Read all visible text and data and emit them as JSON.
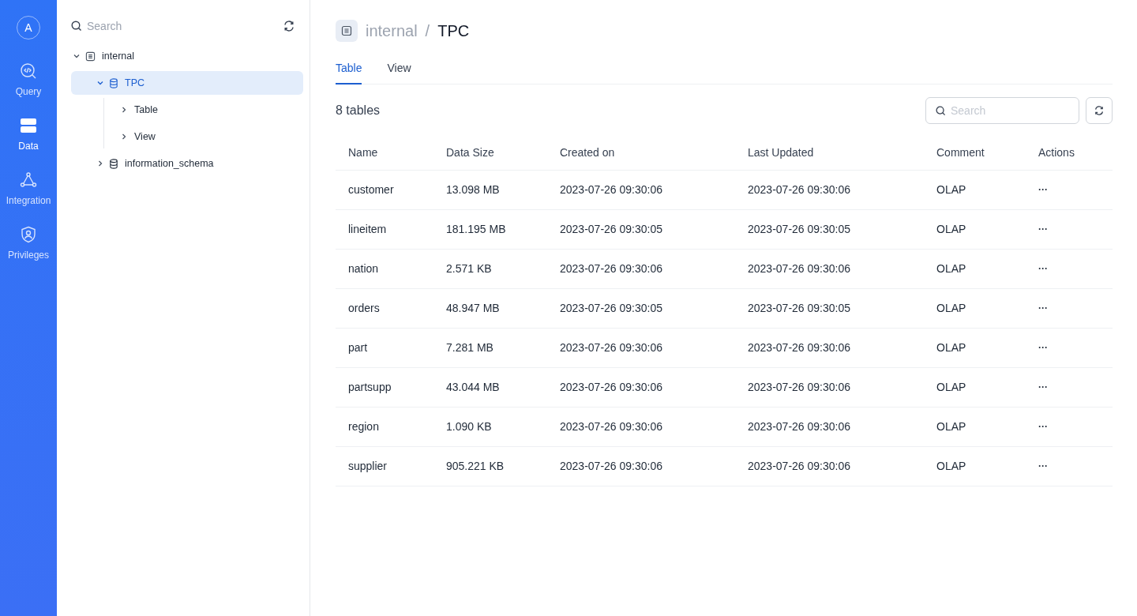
{
  "nav": {
    "avatar": "A",
    "items": [
      {
        "label": "Query",
        "kind": "query",
        "selected": false
      },
      {
        "label": "Data",
        "kind": "data",
        "selected": true
      },
      {
        "label": "Integration",
        "kind": "integration",
        "selected": false
      },
      {
        "label": "Privileges",
        "kind": "privileges",
        "selected": false
      }
    ]
  },
  "tree_panel": {
    "search": {
      "placeholder": "Search"
    },
    "tree": [
      {
        "label": "internal",
        "kind": "catalog",
        "expanded": true,
        "selected": false,
        "children": [
          {
            "label": "TPC",
            "kind": "database",
            "expanded": true,
            "selected": true,
            "children": [
              {
                "label": "Table",
                "expanded": false,
                "selected": false
              },
              {
                "label": "View",
                "expanded": false,
                "selected": false
              }
            ]
          },
          {
            "label": "information_schema",
            "kind": "database",
            "expanded": false,
            "selected": false
          }
        ]
      }
    ]
  },
  "header": {
    "breadcrumb": [
      "internal",
      "TPC"
    ],
    "separator": "/"
  },
  "tabs": [
    {
      "label": "Table",
      "selected": true
    },
    {
      "label": "View",
      "selected": false
    }
  ],
  "count": "8 tables",
  "search": {
    "placeholder": "Search"
  },
  "table": {
    "columns": [
      "Name",
      "Data Size",
      "Created on",
      "Last Updated",
      "Comment",
      "Actions"
    ],
    "rows": [
      [
        "customer",
        "13.098 MB",
        "2023-07-26 09:30:06",
        "2023-07-26 09:30:06",
        "OLAP",
        "···"
      ],
      [
        "lineitem",
        "181.195 MB",
        "2023-07-26 09:30:05",
        "2023-07-26 09:30:05",
        "OLAP",
        "···"
      ],
      [
        "nation",
        "2.571 KB",
        "2023-07-26 09:30:06",
        "2023-07-26 09:30:06",
        "OLAP",
        "···"
      ],
      [
        "orders",
        "48.947 MB",
        "2023-07-26 09:30:05",
        "2023-07-26 09:30:05",
        "OLAP",
        "···"
      ],
      [
        "part",
        "7.281 MB",
        "2023-07-26 09:30:06",
        "2023-07-26 09:30:06",
        "OLAP",
        "···"
      ],
      [
        "partsupp",
        "43.044 MB",
        "2023-07-26 09:30:06",
        "2023-07-26 09:30:06",
        "OLAP",
        "···"
      ],
      [
        "region",
        "1.090 KB",
        "2023-07-26 09:30:06",
        "2023-07-26 09:30:06",
        "OLAP",
        "···"
      ],
      [
        "supplier",
        "905.221 KB",
        "2023-07-26 09:30:06",
        "2023-07-26 09:30:06",
        "OLAP",
        "···"
      ]
    ]
  }
}
